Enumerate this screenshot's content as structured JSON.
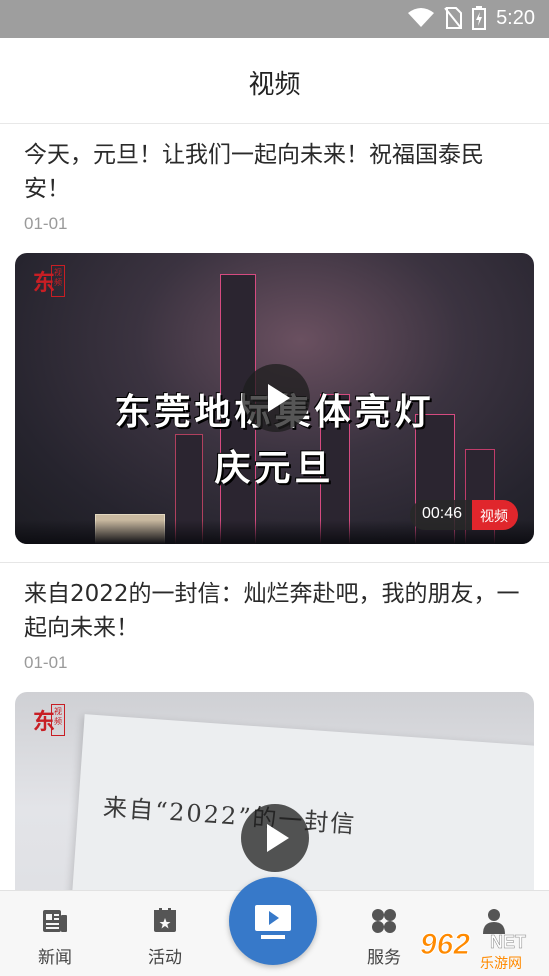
{
  "status_bar": {
    "time": "5:20",
    "icons": [
      "wifi-icon",
      "no-sim-icon",
      "battery-charging-icon"
    ]
  },
  "header": {
    "title": "视频"
  },
  "feed": [
    {
      "title": "今天，元旦！让我们一起向未来！祝福国泰民安！",
      "date": "01-01",
      "video": {
        "overlay_title_line1": "东莞地标集体亮灯",
        "overlay_title_line2": "庆元旦",
        "duration": "00:46",
        "tag": "视频"
      }
    },
    {
      "title": "来自2022的一封信：灿烂奔赴吧，我的朋友，一起向未来！",
      "date": "01-01",
      "video": {
        "overlay_text": "来自“2022”的一封信"
      }
    }
  ],
  "bottom_nav": {
    "items": [
      {
        "label": "新闻",
        "icon": "newspaper-icon"
      },
      {
        "label": "活动",
        "icon": "calendar-icon"
      },
      {
        "label": "",
        "icon": "video-play-icon"
      },
      {
        "label": "服务",
        "icon": "grid-icon"
      },
      {
        "label": "",
        "icon": "user-icon"
      }
    ]
  },
  "watermark": {
    "text": "962",
    "sub": "乐游网",
    "suffix": "NET"
  },
  "colors": {
    "accent": "#3779c9",
    "tag_red": "#e0262c",
    "status_bar": "#9e9e9e"
  }
}
